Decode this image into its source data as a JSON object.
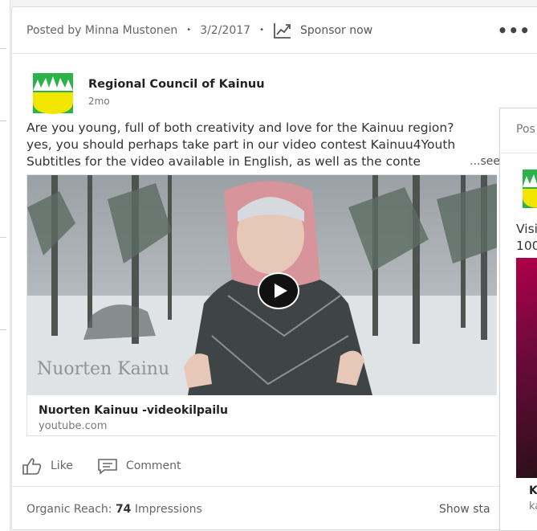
{
  "post": {
    "posted_by": "Posted by Minna Mustonen",
    "date": "3/2/2017",
    "separator": "•",
    "sponsor_label": "Sponsor now",
    "more_menu": "•••",
    "org_name": "Regional Council of Kainuu",
    "org_time": "2mo",
    "text_lines": [
      "Are you young, full of both creativity and love for the Kainuu region?",
      "yes, you should perhaps take part in our video contest Kainuu4Youth",
      "Subtitles for the video available in English, as well as the conte"
    ],
    "see_more": "...see",
    "video_overlay_text": "Nuorten Kainu",
    "link_title": "Nuorten Kainuu -videokilpailu",
    "link_domain": "youtube.com",
    "like_label": "Like",
    "comment_label": "Comment",
    "reach_label": "Organic Reach:",
    "reach_value": "74",
    "reach_unit": "Impressions",
    "show_stats": "Show sta"
  },
  "second_post": {
    "header": "Pos",
    "text_lines": [
      "Visi",
      "100"
    ],
    "link_title": "K",
    "link_domain": "ka"
  },
  "colors": {
    "logo_green": "#2bb34a",
    "logo_yellow": "#f2e600",
    "link_gray": "#666666"
  },
  "icons": {
    "sponsor": "trend-chart-icon",
    "like": "thumbs-up-icon",
    "comment": "comment-icon",
    "play": "play-icon",
    "more": "more-horizontal-icon"
  }
}
